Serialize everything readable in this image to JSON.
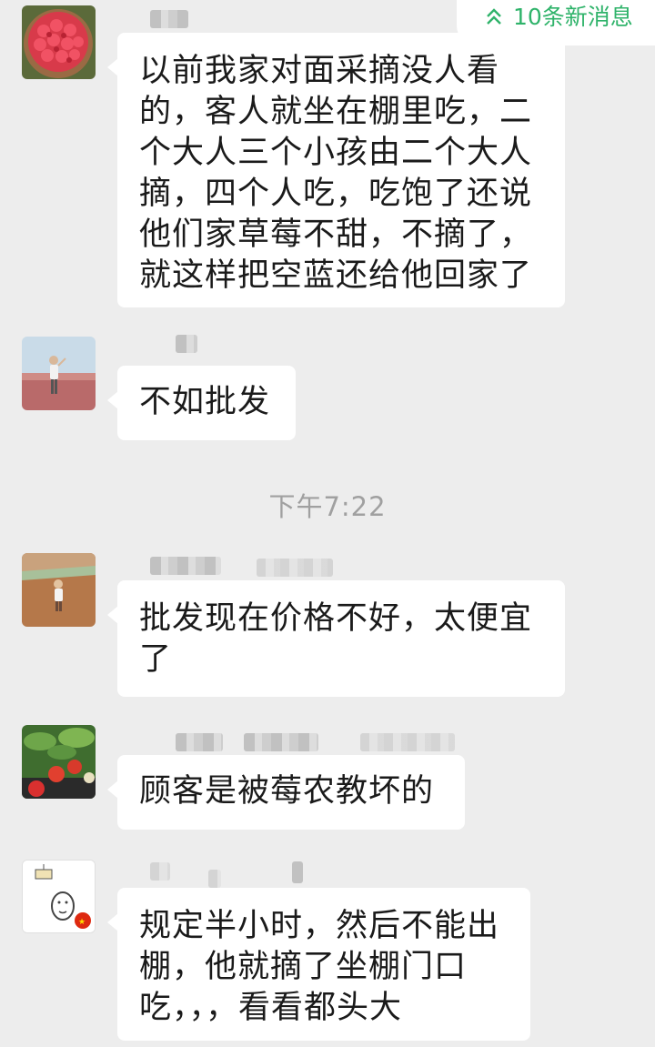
{
  "banner": {
    "new_messages": "10条新消息",
    "icon": "double-chevron-up-icon",
    "color": "#2fb36a"
  },
  "timestamp": "下午7:22",
  "messages": [
    {
      "avatar": "strawberry-basket-avatar",
      "text": "以前我家对面采摘没人看\n的，客人就坐在棚里吃，二\n个大人三个小孩由二个大人\n摘，四个人吃，吃饱了还说\n他们家草莓不甜，不摘了，\n就这样把空蓝还给他回家了"
    },
    {
      "avatar": "field-person-avatar",
      "text": "不如批发"
    },
    {
      "avatar": "child-in-field-avatar",
      "text": "批发现在价格不好，太便宜\n了"
    },
    {
      "avatar": "strawberry-plant-avatar",
      "text": "顾客是被莓农教坏的"
    },
    {
      "avatar": "cartoon-avatar",
      "text": "规定半小时，然后不能出\n棚，他就摘了坐棚门口\n吃，，，看看都头大"
    }
  ],
  "colors": {
    "background": "#ededed",
    "bubble": "#ffffff",
    "text": "#1a1a1a",
    "time": "#a0a0a0"
  }
}
